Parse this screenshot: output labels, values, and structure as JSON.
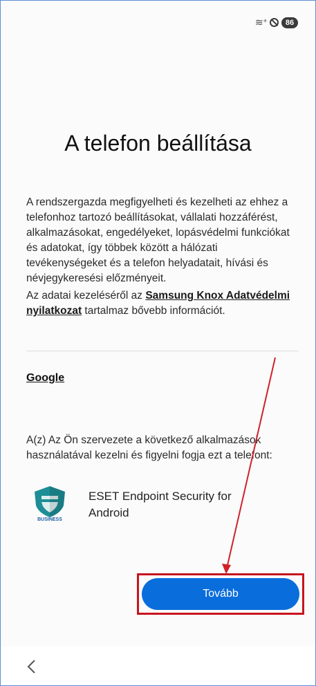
{
  "status_bar": {
    "wifi_icon": "wifi-icon",
    "dnd_icon": "do-not-disturb-icon",
    "battery": "86"
  },
  "page": {
    "title": "A telefon beállítása",
    "paragraph1": "A rendszergazda megfigyelheti és kezelheti az ehhez a telefonhoz tartozó beállításokat, vállalati hozzáférést, alkalmazásokat, engedélyeket, lopásvédelmi funkciókat és adatokat, így többek között a hálózati tevékenységeket és a telefon helyadatait, hívási és névjegykeresési előzményeit.",
    "paragraph2_prefix": "Az adatai kezeléséről az ",
    "privacy_link": "Samsung Knox Adatvédelmi nyilatkozat",
    "paragraph2_suffix": " tartalmaz bővebb információt.",
    "google_link": "Google",
    "paragraph3": "A(z) Az Ön szervezete a következő alkalmazások használatával kezelni és figyelni fogja ezt a telefont:",
    "app": {
      "name": "ESET Endpoint Security for Android",
      "badge": "BUSINESS",
      "icon": "eset-shield-icon"
    },
    "next_button": "Tovább"
  },
  "colors": {
    "accent": "#0a6ddc",
    "highlight": "#c8141e",
    "logo": "#1e8e96"
  },
  "nav": {
    "back_icon": "back-chevron-icon"
  }
}
